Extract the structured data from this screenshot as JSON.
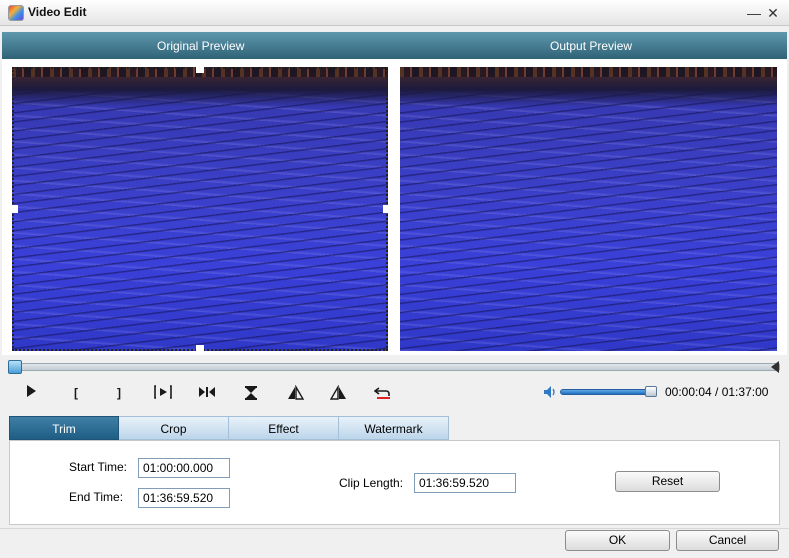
{
  "window": {
    "title": "Video Edit",
    "minimize_symbol": "—",
    "close_symbol": "✕"
  },
  "preview": {
    "original_label": "Original Preview",
    "output_label": "Output Preview"
  },
  "controls": {
    "play_symbol": "▶",
    "set_start_symbol": "[",
    "set_end_symbol": "]",
    "time_display": "00:00:04 / 01:37:00",
    "volume_level": 0.92
  },
  "tabs": [
    {
      "label": "Trim",
      "active": true
    },
    {
      "label": "Crop",
      "active": false
    },
    {
      "label": "Effect",
      "active": false
    },
    {
      "label": "Watermark",
      "active": false
    }
  ],
  "trim": {
    "start_time_label": "Start Time:",
    "start_time_value": "01:00:00.000",
    "end_time_label": "End Time:",
    "end_time_value": "01:36:59.520",
    "clip_length_label": "Clip Length:",
    "clip_length_value": "01:36:59.520",
    "reset_label": "Reset"
  },
  "footer": {
    "ok_label": "OK",
    "cancel_label": "Cancel"
  },
  "icons": {
    "app": "app-logo-icon",
    "volume": "speaker-icon"
  },
  "colors": {
    "header_bar": "#2f6277",
    "active_tab": "#1f5e84",
    "water": "#3a40d8"
  }
}
